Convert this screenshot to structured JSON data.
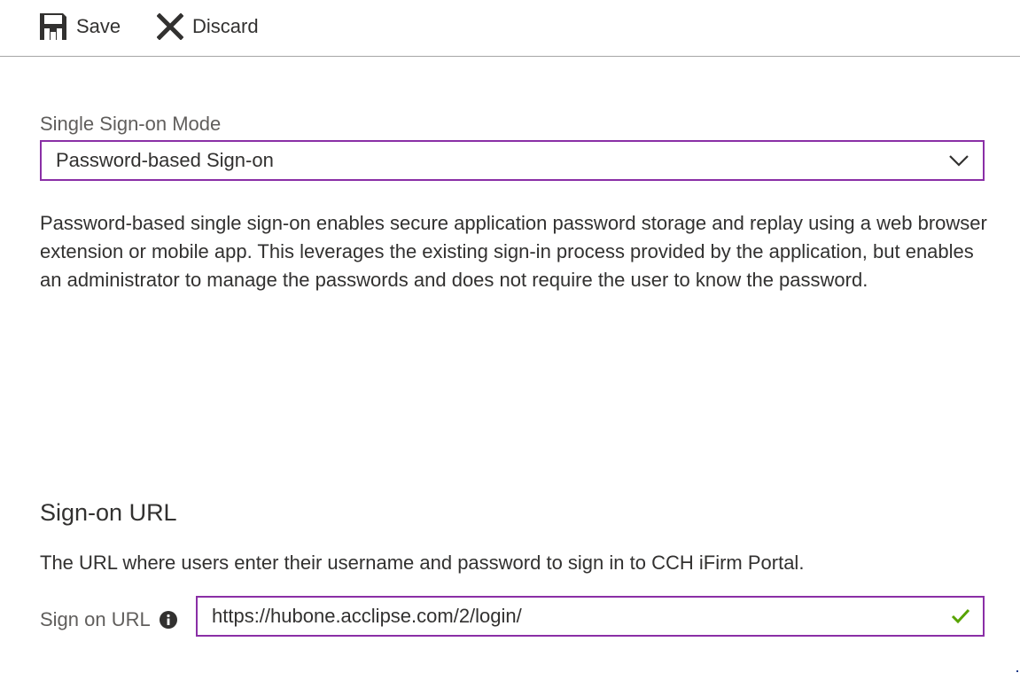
{
  "toolbar": {
    "save_label": "Save",
    "discard_label": "Discard"
  },
  "sso": {
    "label": "Single Sign-on Mode",
    "selected": "Password-based Sign-on",
    "description": "Password-based single sign-on enables secure application password storage and replay using a web browser extension or mobile app. This leverages the existing sign-in process provided by the application, but enables an administrator to manage the passwords and does not require the user to know the password."
  },
  "signon": {
    "title": "Sign-on URL",
    "description": "The URL where users enter their username and password to sign in to CCH iFirm Portal.",
    "field_label": "Sign on URL",
    "value": "https://hubone.acclipse.com/2/login/"
  },
  "icons": {
    "save": "save-icon",
    "discard": "close-icon",
    "dropdown": "chevron-down-icon",
    "info": "info-icon",
    "valid": "checkmark-icon"
  },
  "colors": {
    "focus_border": "#8a2fa6",
    "valid_check": "#57a300",
    "text": "#323130",
    "label": "#605e5c"
  }
}
